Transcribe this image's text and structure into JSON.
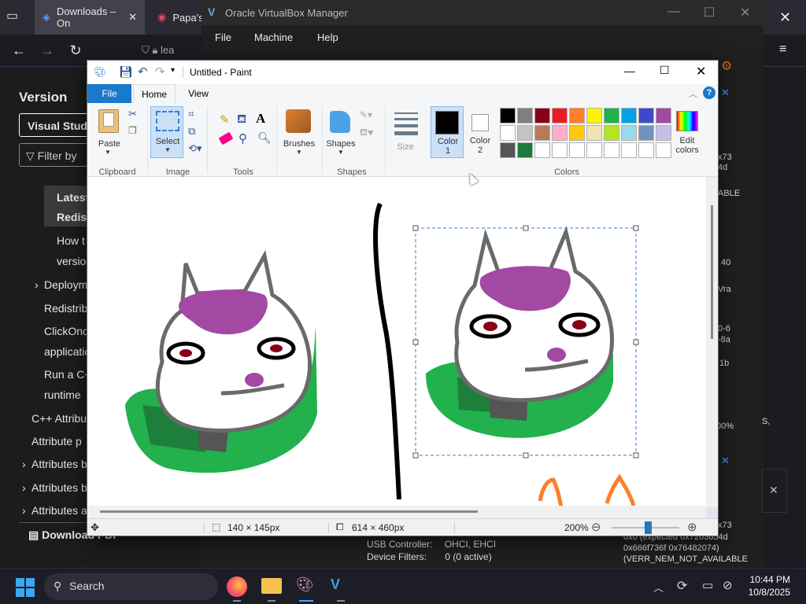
{
  "browser": {
    "tab1": "Downloads – On",
    "tab2": "Papa's",
    "address_partial": "lea",
    "doc_title": "Version",
    "search_btn": "Visual Studi",
    "filter": "Filter by",
    "right_label": "ble"
  },
  "doc_nav": [
    {
      "text": "Latest"
    },
    {
      "text": "Redist"
    },
    {
      "text": "How t"
    },
    {
      "text": "versio"
    },
    {
      "text": "Deploym"
    },
    {
      "text": "Redistrib"
    },
    {
      "text": "ClickOnc"
    },
    {
      "text": "applicatio"
    },
    {
      "text": "Run a C+"
    },
    {
      "text": "runtime"
    },
    {
      "text": "C++ Attribu"
    },
    {
      "text": "Attribute p"
    },
    {
      "text": "Attributes b"
    },
    {
      "text": "Attributes b"
    },
    {
      "text": "Attributes a"
    },
    {
      "text": "Download PDF"
    }
  ],
  "vbox": {
    "title": "Oracle VirtualBox Manager",
    "menu": [
      "File",
      "Machine",
      "Help"
    ],
    "usb_label": "USB Controller:",
    "usb_value": "OHCI, EHCI",
    "filters_label": "Device Filters:",
    "filters_value": "0 (0 active)",
    "err_lines": [
      "0x0 (expected 0x7263654d",
      "0x666f736f 0x76482074)",
      "(VERR_NEM_NOT_AVAILABLE"
    ],
    "side_codes": [
      "x73",
      "4d",
      "ABLE",
      "40",
      "Vra",
      "0-6",
      "-8a",
      "1b",
      "00%",
      "S,",
      "x73"
    ]
  },
  "paint": {
    "title": "Untitled - Paint",
    "tabs": {
      "file": "File",
      "home": "Home",
      "view": "View"
    },
    "tools": {
      "paste": "Paste",
      "select": "Select",
      "brushes": "Brushes",
      "shapes": "Shapes",
      "size": "Size",
      "color1": "Color\n1",
      "color2": "Color\n2",
      "edit_colors": "Edit\ncolors"
    },
    "groups": {
      "clipboard": "Clipboard",
      "image": "Image",
      "tools": "Tools",
      "shapes": "Shapes",
      "colors": "Colors"
    },
    "palette": [
      "#000000",
      "#7f7f7f",
      "#880015",
      "#ed1c24",
      "#ff7f27",
      "#fff200",
      "#22b14c",
      "#00a2e8",
      "#3f48cc",
      "#a349a4",
      "#ffffff",
      "#c3c3c3",
      "#b97a57",
      "#ffaec9",
      "#ffc90e",
      "#efe4b0",
      "#b5e61d",
      "#99d9ea",
      "#7092be",
      "#c8bfe7",
      "#555555",
      "#1e7a3c",
      "#ffffff",
      "#ffffff",
      "#ffffff",
      "#ffffff",
      "#ffffff",
      "#ffffff",
      "#ffffff",
      "#ffffff"
    ],
    "status": {
      "selection_size": "140 × 145px",
      "image_size": "614 × 460px",
      "zoom": "200%"
    }
  },
  "taskbar": {
    "search": "Search",
    "time": "10:44 PM",
    "date": "10/8/2025"
  }
}
